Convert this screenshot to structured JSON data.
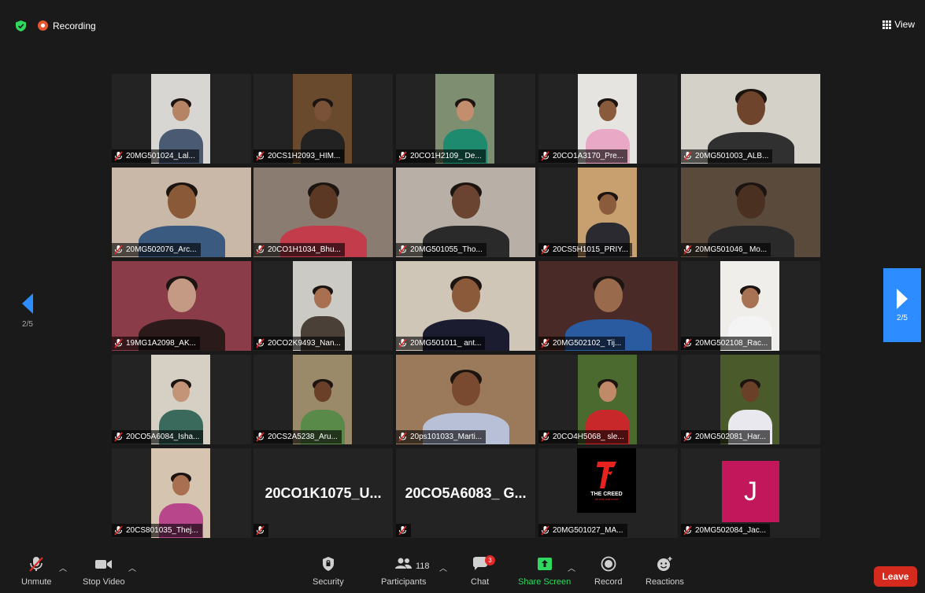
{
  "topbar": {
    "recording_label": "Recording",
    "view_label": "View"
  },
  "pagination": {
    "left_page": "2/5",
    "right_page": "2/5"
  },
  "participants": [
    {
      "name": "20MG501024_Lal...",
      "bg": "#d8d6d2",
      "skin": "#b58464",
      "shirt": "#4a5a72",
      "inset": true
    },
    {
      "name": "20CS1H2093_HIM...",
      "bg": "#6a4a2c",
      "skin": "#7a5238",
      "shirt": "#222222",
      "inset": true
    },
    {
      "name": "20CO1H2109_ De...",
      "bg": "#7d8f70",
      "skin": "#c28e6d",
      "shirt": "#1e8a6e",
      "inset": true
    },
    {
      "name": "20CO1A3170_Pre...",
      "bg": "#e6e4e0",
      "skin": "#8a5a3c",
      "shirt": "#e8a8c6",
      "inset": true
    },
    {
      "name": "20MG501003_ALB...",
      "bg": "#d4d1c8",
      "skin": "#6e452c",
      "shirt": "#303030",
      "inset": false
    },
    {
      "name": "20MG502076_Arc...",
      "bg": "#c9b8a8",
      "skin": "#8a5a38",
      "shirt": "#3a5a80",
      "inset": false
    },
    {
      "name": "20CO1H1034_Bhu...",
      "bg": "#8a7c70",
      "skin": "#5a3824",
      "shirt": "#c23c4c",
      "inset": false
    },
    {
      "name": "20MG501055_Tho...",
      "bg": "#b8b0a6",
      "skin": "#6a4430",
      "shirt": "#2a2a2a",
      "inset": false
    },
    {
      "name": "20CS5H1015_PRIY...",
      "bg": "#c8a070",
      "skin": "#8a5c3c",
      "shirt": "#2a2a30",
      "inset": true
    },
    {
      "name": "20MG501046_ Mo...",
      "bg": "#5a4a3c",
      "skin": "#4a3020",
      "shirt": "#2a2a2a",
      "inset": false
    },
    {
      "name": "19MG1A2098_AK...",
      "bg": "#8a3c48",
      "skin": "#c49a84",
      "shirt": "#2a1a1a",
      "inset": false
    },
    {
      "name": "20CO2K9493_Nan...",
      "bg": "#cccac4",
      "skin": "#a87050",
      "shirt": "#4a4038",
      "inset": true
    },
    {
      "name": "20MG501011_ ant...",
      "bg": "#cfc6b8",
      "skin": "#8a5a3a",
      "shirt": "#1c1c30",
      "inset": false
    },
    {
      "name": "20MG502102_ Tij...",
      "bg": "#4a2a26",
      "skin": "#9a6a4c",
      "shirt": "#2a5aa0",
      "inset": false
    },
    {
      "name": "20MG502108_Rac...",
      "bg": "#f0eeea",
      "skin": "#a87254",
      "shirt": "#f4f4f4",
      "inset": true
    },
    {
      "name": "20CO5A6084_Isha...",
      "bg": "#d6d0c4",
      "skin": "#c49478",
      "shirt": "#3a6a5c",
      "inset": true
    },
    {
      "name": "20CS2A5238_Aru...",
      "bg": "#9a8a6a",
      "skin": "#6a4028",
      "shirt": "#5a8a4a",
      "inset": true
    },
    {
      "name": "20ps101033_Marti...",
      "bg": "#9a7a5a",
      "skin": "#7a4a30",
      "shirt": "#b8c0d8",
      "inset": false
    },
    {
      "name": "20CO4H5068_ sle...",
      "bg": "#4a6a30",
      "skin": "#c08a68",
      "shirt": "#c8282a",
      "inset": true
    },
    {
      "name": "20MG502081_Har...",
      "bg": "#4a5a2a",
      "skin": "#6a4028",
      "shirt": "#e8e8ee",
      "inset": true
    },
    {
      "name": "20CS801035_Thej...",
      "bg": "#d4c4b0",
      "skin": "#a87050",
      "shirt": "#b8468a",
      "inset": true
    },
    {
      "name": "",
      "big": "20CO1K1075_U...",
      "bg": "#232323"
    },
    {
      "name": "",
      "big": "20CO5A6083_ G...",
      "bg": "#232323"
    },
    {
      "name": "20MG501027_MA...",
      "bg": "#1a1a1a",
      "logo": "creed",
      "logo_title": "THE CREED",
      "logo_sub": "All this and more"
    },
    {
      "name": "20MG502084_Jac...",
      "bg": "#232323",
      "logo": "letter",
      "letter": "J"
    }
  ],
  "toolbar": {
    "unmute_label": "Unmute",
    "stop_video_label": "Stop Video",
    "security_label": "Security",
    "participants_label": "Participants",
    "participants_count": "118",
    "chat_label": "Chat",
    "chat_badge": "3",
    "share_screen_label": "Share Screen",
    "record_label": "Record",
    "reactions_label": "Reactions",
    "leave_label": "Leave"
  },
  "colors": {
    "accent": "#2d8cff",
    "leave": "#d52b1e",
    "share": "#2fd85f",
    "mute": "#e02828",
    "letter_tile": "#c2185b"
  }
}
